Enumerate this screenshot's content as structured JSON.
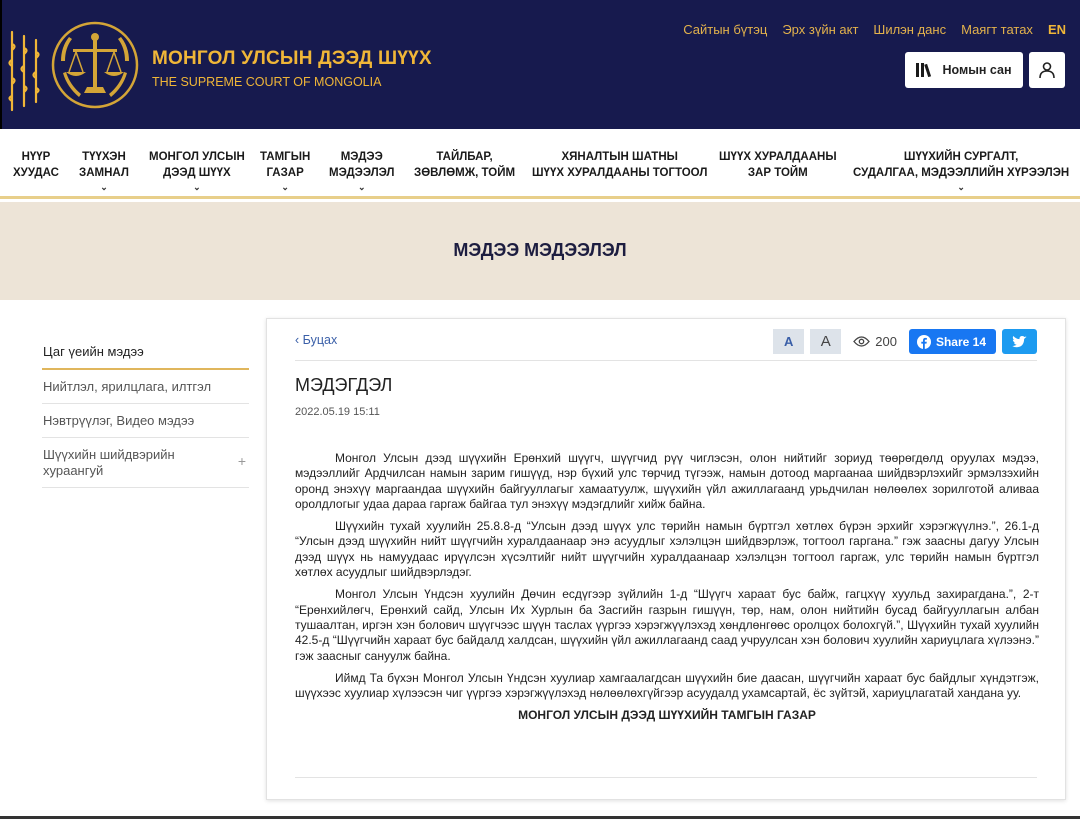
{
  "header": {
    "title_mn": "МОНГОЛ УЛСЫН ДЭЭД ШҮҮХ",
    "title_en": "THE SUPREME COURT OF MONGOLIA",
    "emblem_icon": "scales-of-justice-emblem",
    "top_links": [
      "Сайтын бүтэц",
      "Эрх зүйн акт",
      "Шилэн данс",
      "Маягт татах"
    ],
    "lang": "EN",
    "library_label": "Номын сан",
    "colors": {
      "primary": "#171a4e",
      "gold": "#f0b638"
    }
  },
  "nav": {
    "items": [
      {
        "line1": "НҮҮР",
        "line2": "ХУУДАС"
      },
      {
        "line1": "ТҮҮХЭН",
        "line2": "ЗАМНАЛ"
      },
      {
        "line1": "МОНГОЛ УЛСЫН",
        "line2": "ДЭЭД ШҮҮХ"
      },
      {
        "line1": "ТАМГЫН",
        "line2": "ГАЗАР"
      },
      {
        "line1": "МЭДЭЭ",
        "line2": "МЭДЭЭЛЭЛ"
      },
      {
        "line1": "ТАЙЛБАР,",
        "line2": "ЗӨВЛӨМЖ, ТОЙМ"
      },
      {
        "line1": "ХЯНАЛТЫН ШАТНЫ",
        "line2": "ШҮҮХ ХУРАЛДААНЫ ТОГТООЛ"
      },
      {
        "line1": "ШҮҮХ ХУРАЛДААНЫ",
        "line2": "ЗАР ТОЙМ"
      },
      {
        "line1": "ШҮҮХИЙН СУРГАЛТ,",
        "line2": "СУДАЛГАА, МЭДЭЭЛЛИЙН ХҮРЭЭЛЭН"
      }
    ]
  },
  "banner": {
    "title": "МЭДЭЭ МЭДЭЭЛЭЛ"
  },
  "sidebar": {
    "items": [
      {
        "label": "Цаг үеийн мэдээ"
      },
      {
        "label": "Нийтлэл, ярилцлага, илтгэл"
      },
      {
        "label": "Нэвтрүүлэг, Видео мэдээ"
      },
      {
        "label": "Шүүхийн шийдвэрийн хураангуй"
      }
    ]
  },
  "article": {
    "back_label": "Буцах",
    "font_small": "A",
    "font_large": "A",
    "views": "200",
    "share_label": "Share 14",
    "title": "МЭДЭГДЭЛ",
    "date": "2022.05.19 15:11",
    "paragraphs": [
      "Монгол Улсын дээд шүүхийн Ерөнхий шүүгч, шүүгчид рүү чиглэсэн, олон нийтийг зориуд төөрөгдөлд оруулах мэдээ, мэдээллийг Ардчилсан намын зарим гишүүд, нэр бүхий улс төрчид түгээж, намын дотоод маргаанаа шийдвэрлэхийг эрмэлзэхийн оронд энэхүү маргаандаа шүүхийн байгууллагыг хамаатуулж, шүүхийн үйл ажиллагаанд урьдчилан нөлөөлөх зорилготой аливаа оролдлогыг удаа дараа гаргаж байгаа тул энэхүү мэдэгдлийг хийж байна.",
      "Шүүхийн тухай хуулийн 25.8.8-д “Улсын дээд шүүх улс төрийн намын бүртгэл хөтлөх бүрэн эрхийг хэрэгжүүлнэ.”, 26.1-д “Улсын дээд шүүхийн нийт шүүгчийн хуралдаанаар энэ асуудлыг хэлэлцэн шийдвэрлэж, тогтоол гаргана.” гэж заасны дагуу Улсын дээд шүүх нь намуудаас ирүүлсэн хүсэлтийг нийт шүүгчийн хуралдаанаар хэлэлцэн тогтоол гаргаж, улс төрийн намын бүртгэл хөтлөх асуудлыг шийдвэрлэдэг.",
      "Монгол Улсын Үндсэн хуулийн Дөчин есдүгээр зүйлийн 1-д “Шүүгч хараат бус байж, гагцхүү хуульд захирагдана.”, 2-т “Ерөнхийлөгч, Ерөнхий сайд, Улсын Их Хурлын ба Засгийн газрын гишүүн, төр, нам, олон нийтийн бусад байгууллагын албан тушаалтан, иргэн хэн болович шүүгчээс шүүн таслах үүргээ хэрэгжүүлэхэд хөндлөнгөөс оролцох болохгүй.”, Шүүхийн тухай хуулийн 42.5-д “Шүүгчийн хараат бус байдалд халдсан, шүүхийн үйл ажиллагаанд саад учруулсан хэн болович хуулийн хариуцлага хүлээнэ.” гэж заасныг  сануулж байна.",
      "Иймд Та бүхэн Монгол Улсын Үндсэн хуулиар хамгаалагдсан шүүхийн бие даасан, шүүгчийн хараат бус байдлыг хүндэтгэж, шүүхээс хуулиар хүлээсэн чиг үүргээ хэрэгжүүлэхэд нөлөөлөхгүйгээр асуудалд ухамсартай, ёс зүйтэй, хариуцлагатай хандана уу."
    ],
    "signature": "МОНГОЛ УЛСЫН ДЭЭД ШҮҮХИЙН ТАМГЫН ГАЗАР"
  }
}
